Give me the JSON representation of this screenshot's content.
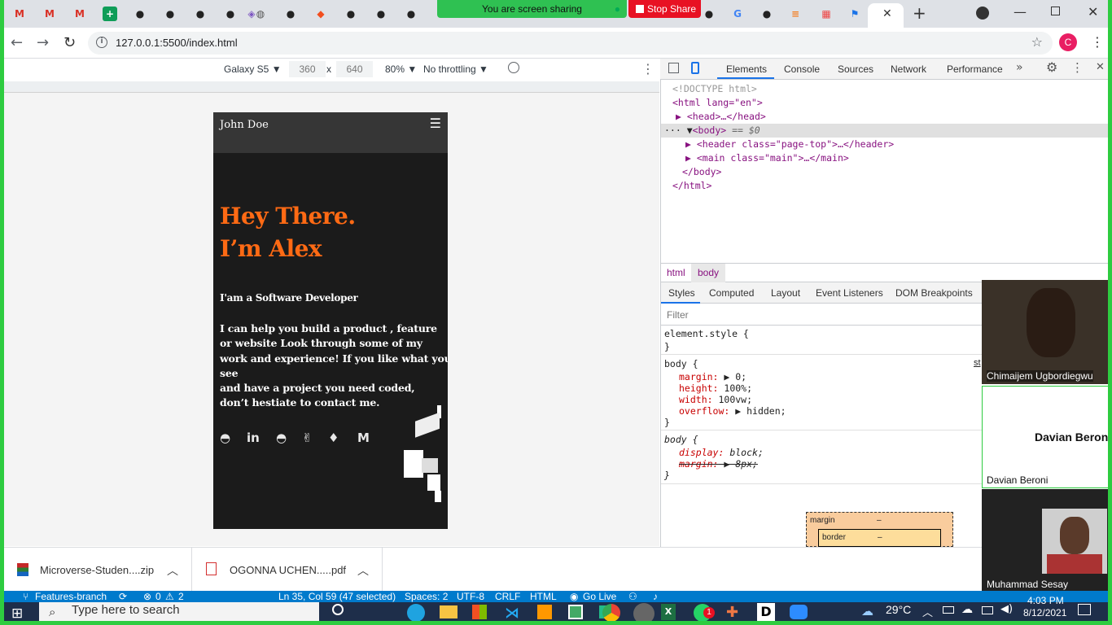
{
  "browser": {
    "share_banner": "You are screen sharing",
    "stop_share": "Stop Share",
    "url": "127.0.0.1:5500/index.html",
    "profile_initial": "C",
    "tab_icons": [
      "gmail-icon",
      "gmail-icon",
      "gmail-icon",
      "sheets-icon",
      "github-icon",
      "github-icon",
      "github-icon",
      "github-icon",
      "app-icon",
      "globe-icon",
      "github-icon",
      "figma-icon",
      "github-icon",
      "github-icon",
      "github-icon",
      "google-icon",
      "github-icon",
      "stackoverflow-icon",
      "app-icon",
      "flag-icon"
    ]
  },
  "device_toolbar": {
    "device": "Galaxy S5",
    "width": "360",
    "x": "x",
    "height": "640",
    "zoom": "80%",
    "throttle": "No throttling"
  },
  "page": {
    "brand": "John Doe",
    "hero_line1": "Hey There.",
    "hero_line2": "I’m Alex",
    "role": "I'am a Software Developer",
    "intro_line1": "I can help you build a product , feature",
    "intro_line2": "or website Look through some of my",
    "intro_line3": "work and experience! If you like what you",
    "intro_line4": "see",
    "intro_line5": "and have a project you need coded,",
    "intro_line6": "don’t hestiate to contact me."
  },
  "devtools": {
    "tabs": [
      "Elements",
      "Console",
      "Sources",
      "Network",
      "Performance"
    ],
    "active_tab": "Elements",
    "dom": {
      "doctype": "<!DOCTYPE html>",
      "html_open": "<html lang=\"en\">",
      "head": "<head>…</head>",
      "body_open": "<body>",
      "body_eq": "== $0",
      "header": "<header class=\"page-top\">…</header>",
      "main": "<main class=\"main\">…</main>",
      "body_close": "</body>",
      "html_close": "</html>"
    },
    "breadcrumb": [
      "html",
      "body"
    ],
    "styles_tabs": [
      "Styles",
      "Computed",
      "Layout",
      "Event Listeners",
      "DOM Breakpoints"
    ],
    "filter_placeholder": "Filter",
    "rule1": {
      "selector": "element.style {",
      "close": "}"
    },
    "rule2": {
      "selector": "body {",
      "p1": "margin:",
      "v1": "0;",
      "p2": "height:",
      "v2": "100%;",
      "p3": "width:",
      "v3": "100vw;",
      "p4": "overflow:",
      "v4": "hidden;",
      "close": "}",
      "source": "st"
    },
    "rule3": {
      "selector": "body {",
      "p1": "display:",
      "v1": "block;",
      "p2": "margin:",
      "v2": "8px;",
      "close": "}"
    },
    "box_margin": "margin",
    "box_margin_val": "–",
    "box_border": "border",
    "box_border_val": "–"
  },
  "participants": [
    {
      "name": "Chimaijem Ugbordiegwu"
    },
    {
      "name": "Davian Beroni",
      "display": "Davian Beron"
    },
    {
      "name": "Muhammad Sesay"
    }
  ],
  "downloads": [
    {
      "name": "Microverse-Studen....zip"
    },
    {
      "name": "OGONNA UCHEN.....pdf"
    }
  ],
  "vscode_status": {
    "branch": "Features-branch",
    "errors": "0",
    "warnings": "2",
    "position": "Ln 35, Col 59 (47 selected)",
    "spaces": "Spaces: 2",
    "encoding": "UTF-8",
    "eol": "CRLF",
    "lang": "HTML",
    "golive": "Go Live"
  },
  "taskbar": {
    "search": "Type here to search",
    "temp": "29°C",
    "time": "4:03 PM",
    "date": "8/12/2021",
    "badge": "1"
  }
}
